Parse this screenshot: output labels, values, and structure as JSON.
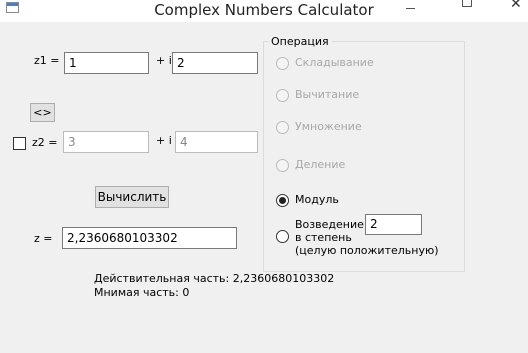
{
  "window": {
    "title": "Complex Numbers Calculator"
  },
  "z1": {
    "label": "z1 =",
    "real": "1",
    "imag_label": "+ i",
    "imag": "2"
  },
  "swap_button": {
    "label": "<>"
  },
  "z2": {
    "checked": false,
    "label": "z2 =",
    "real": "3",
    "imag_label": "+ i",
    "imag": "4"
  },
  "compute_button": {
    "label": "Вычислить"
  },
  "result": {
    "label": "z =",
    "value": "2,2360680103302"
  },
  "details": {
    "real_part": "Действительная часть: 2,2360680103302",
    "imag_part": "Мнимая часть: 0"
  },
  "operations": {
    "title": "Операция",
    "items": [
      {
        "label": "Складывание",
        "enabled": false,
        "selected": false
      },
      {
        "label": "Вычитание",
        "enabled": false,
        "selected": false
      },
      {
        "label": "Умножение",
        "enabled": false,
        "selected": false
      },
      {
        "label": "Деление",
        "enabled": false,
        "selected": false
      },
      {
        "label": "Модуль",
        "enabled": true,
        "selected": true
      }
    ],
    "power": {
      "label_line1": "Возведение",
      "label_line2": "в степень",
      "hint": "(целую положительную)",
      "value": "2",
      "selected": false
    }
  }
}
